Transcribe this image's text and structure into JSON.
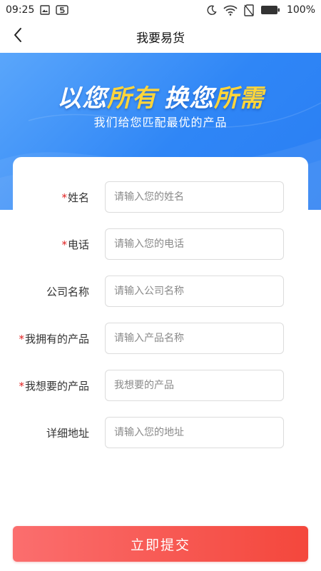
{
  "status_bar": {
    "time": "09:25",
    "battery": "100%",
    "icons": [
      "gallery-icon",
      "app-5-icon",
      "moon-icon",
      "wifi-icon",
      "no-sim-icon",
      "battery-icon"
    ]
  },
  "nav": {
    "title": "我要易货",
    "back_icon": "chevron-left-icon"
  },
  "hero": {
    "headline_part1": "以您",
    "headline_part2": "所有",
    "headline_part3": "换您",
    "headline_part4": "所需",
    "subtitle": "我们给您匹配最优的产品",
    "colors": {
      "primary": "#2f86f6",
      "highlight": "#ffd53a"
    }
  },
  "form": {
    "fields": [
      {
        "label": "姓名",
        "required": true,
        "placeholder": "请输入您的姓名",
        "value": ""
      },
      {
        "label": "电话",
        "required": true,
        "placeholder": "请输入您的电话",
        "value": ""
      },
      {
        "label": "公司名称",
        "required": false,
        "placeholder": "请输入公司名称",
        "value": ""
      },
      {
        "label": "我拥有的产品",
        "required": true,
        "placeholder": "请输入产品名称",
        "value": ""
      },
      {
        "label": "我想要的产品",
        "required": true,
        "placeholder": "我想要的产品",
        "value": ""
      },
      {
        "label": "详细地址",
        "required": false,
        "placeholder": "请输入您的地址",
        "value": ""
      }
    ],
    "required_mark": "*"
  },
  "submit": {
    "label": "立即提交",
    "color": "#f4473c"
  }
}
